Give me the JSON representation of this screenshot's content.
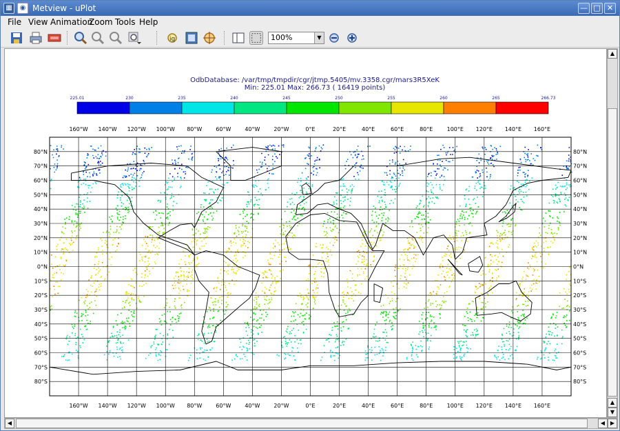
{
  "window": {
    "title": "Metview - uPlot",
    "minimize_glyph": "—",
    "maximize_glyph": "□",
    "close_glyph": "✕"
  },
  "menu": [
    "File",
    "View",
    "Animation",
    "Zoom",
    "Tools",
    "Help"
  ],
  "toolbar": {
    "icons": [
      "save-icon",
      "print-icon",
      "export-icon",
      "zoom-in-icon",
      "zoom-out-icon",
      "zoom-reset-icon",
      "zoom-stack-icon",
      "magnifier-icon",
      "area-select-icon",
      "cursor-data-icon",
      "sidebar-toggle-icon",
      "frame-select-icon",
      "zoom-minus-icon",
      "zoom-plus-icon"
    ],
    "zoom_value": "100%"
  },
  "plot": {
    "title_line1": "OdbDatabase: /var/tmp/tmpdir/cgr/jtmp.5405/mv.3358.cgr/mars3R5XeK",
    "title_line2": "Min: 225.01  Max: 266.73    ( 16419 points)",
    "colorbar": {
      "labels": [
        "225.01",
        "230",
        "235",
        "240",
        "245",
        "250",
        "255",
        "260",
        "265",
        "266.73"
      ],
      "colors": [
        "#0000e6",
        "#0080e6",
        "#00e6e6",
        "#00e680",
        "#00e600",
        "#80e600",
        "#e6e600",
        "#ff8000",
        "#ff0000"
      ]
    },
    "lon_labels": [
      "160°W",
      "140°W",
      "120°W",
      "100°W",
      "80°W",
      "60°W",
      "40°W",
      "20°W",
      "0°E",
      "20°E",
      "40°E",
      "60°E",
      "80°E",
      "100°E",
      "120°E",
      "140°E",
      "160°E"
    ],
    "lat_labels": [
      "80°N",
      "70°N",
      "60°N",
      "50°N",
      "40°N",
      "30°N",
      "20°N",
      "10°N",
      "0°N",
      "10°S",
      "20°S",
      "30°S",
      "40°S",
      "50°S",
      "60°S",
      "70°S",
      "80°S"
    ]
  }
}
